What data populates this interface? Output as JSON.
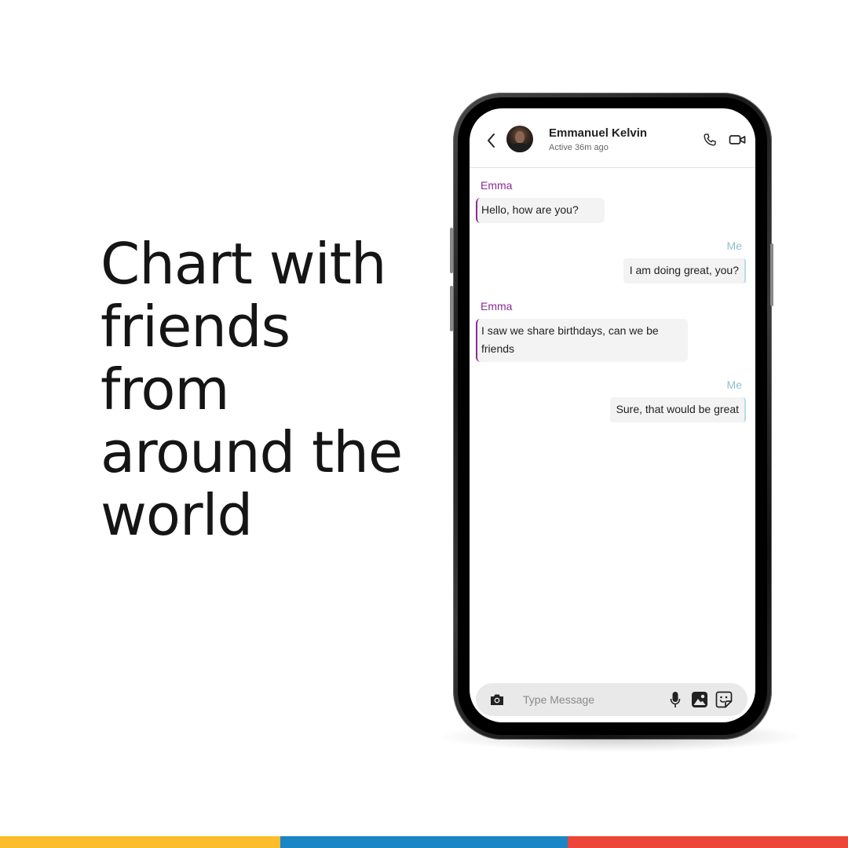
{
  "headline": {
    "lines": [
      "Chart with",
      "friends",
      "from",
      "around the",
      "world"
    ]
  },
  "colors": {
    "stripe": [
      "#fbbd2b",
      "#1b86c6",
      "#ec4539"
    ],
    "them_accent": "#8b2a94",
    "me_accent": "#8fbfcc",
    "bubble_bg": "#f3f3f3",
    "input_bg": "#e9e9e9"
  },
  "chat": {
    "header": {
      "back_icon": "chevron-left-icon",
      "contact_name": "Emmanuel Kelvin",
      "status": "Active 36m ago",
      "call_icon": "phone-icon",
      "video_icon": "video-camera-icon"
    },
    "messages": [
      {
        "from": "them",
        "sender": "Emma",
        "text": "Hello, how are you?"
      },
      {
        "from": "me",
        "sender": "Me",
        "text": "I am doing great, you?"
      },
      {
        "from": "them",
        "sender": "Emma",
        "text": "I saw we share birthdays, can we be friends"
      },
      {
        "from": "me",
        "sender": "Me",
        "text": "Sure, that would be great"
      }
    ],
    "input": {
      "placeholder": "Type Message",
      "value": "",
      "camera_icon": "camera-icon",
      "mic_icon": "microphone-icon",
      "gallery_icon": "gallery-icon",
      "sticker_icon": "sticker-icon"
    }
  }
}
